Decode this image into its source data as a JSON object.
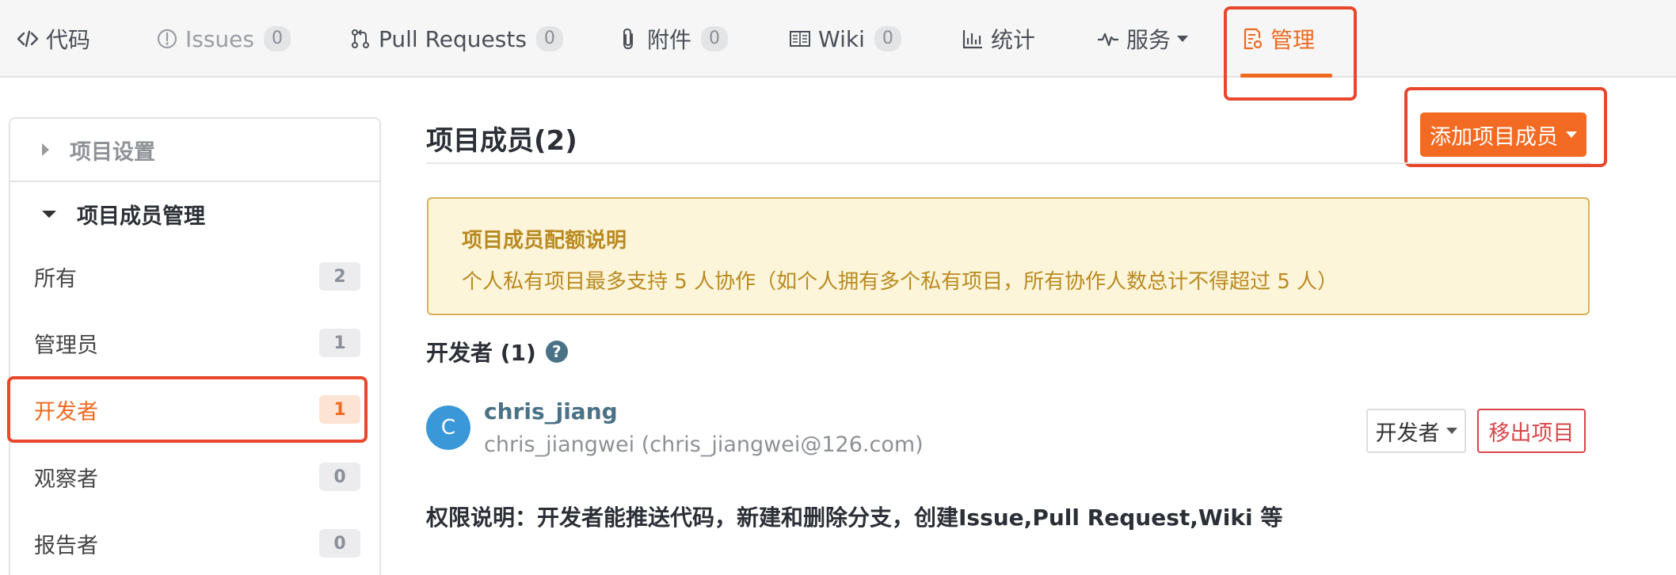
{
  "tabs": [
    {
      "label": "代码",
      "icon": "code-icon",
      "count": null
    },
    {
      "label": "Issues",
      "icon": "issue-icon",
      "count": "0"
    },
    {
      "label": "Pull Requests",
      "icon": "pull-request-icon",
      "count": "0"
    },
    {
      "label": "附件",
      "icon": "paperclip-icon",
      "count": "0"
    },
    {
      "label": "Wiki",
      "icon": "book-icon",
      "count": "0"
    },
    {
      "label": "统计",
      "icon": "bar-chart-icon",
      "count": null
    },
    {
      "label": "服务",
      "icon": "activity-icon",
      "count": null
    },
    {
      "label": "管理",
      "icon": "manage-doc-icon",
      "count": null
    }
  ],
  "sidebar": {
    "settings_label": "项目设置",
    "members_label": "项目成员管理",
    "items": [
      {
        "label": "所有",
        "count": "2"
      },
      {
        "label": "管理员",
        "count": "1"
      },
      {
        "label": "开发者",
        "count": "1"
      },
      {
        "label": "观察者",
        "count": "0"
      },
      {
        "label": "报告者",
        "count": "0"
      }
    ]
  },
  "main": {
    "title": "项目成员(2)",
    "add_button": "添加项目成员",
    "notice": {
      "title": "项目成员配额说明",
      "text": "个人私有项目最多支持 5 人协作（如个人拥有多个私有项目，所有协作人数总计不得超过 5 人）"
    },
    "group_label": "开发者 (1)",
    "member": {
      "avatar_letter": "C",
      "name": "chris_jiang",
      "sub": "chris_jiangwei (chris_jiangwei@126.com)",
      "role": "开发者",
      "remove": "移出项目"
    },
    "permission_note": "权限说明：开发者能推送代码，新建和删除分支，创建Issue,Pull Request,Wiki 等"
  },
  "colors": {
    "accent": "#ee6a21",
    "highlight_box": "#e8472b",
    "link": "#4a7286",
    "danger": "#d9454a",
    "notice_bg": "#fdf5d9"
  }
}
